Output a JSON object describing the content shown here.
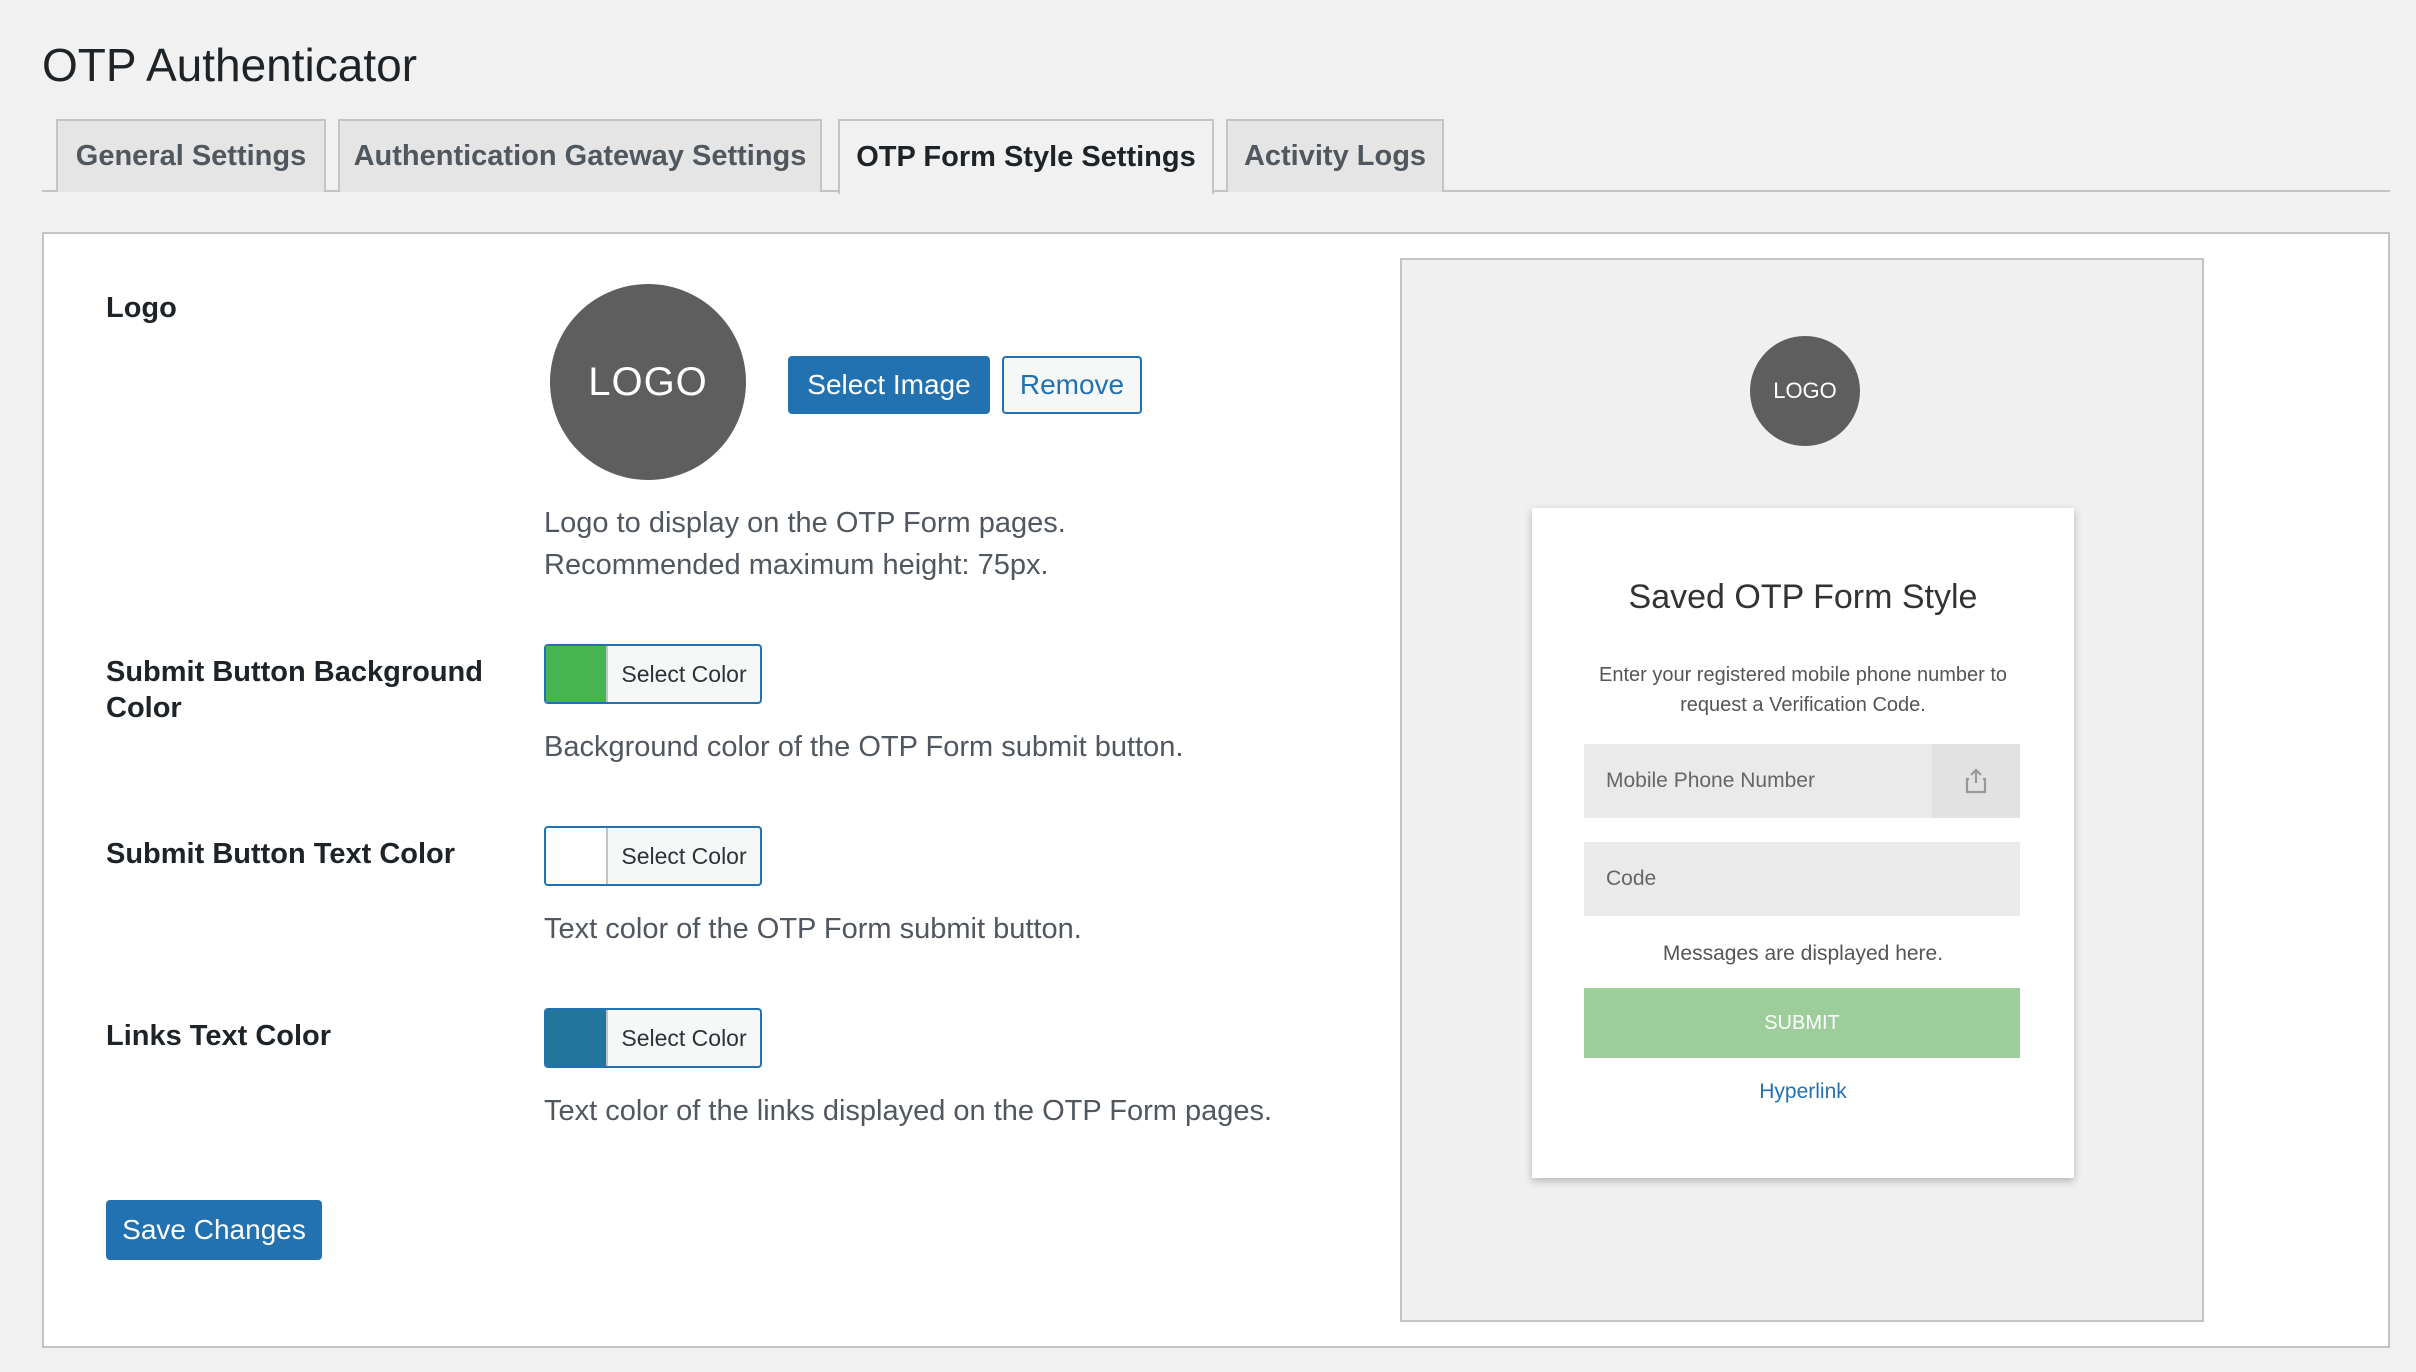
{
  "page": {
    "title": "OTP Authenticator"
  },
  "tabs": [
    {
      "label": "General Settings",
      "active": false
    },
    {
      "label": "Authentication Gateway Settings",
      "active": false
    },
    {
      "label": "OTP Form Style Settings",
      "active": true
    },
    {
      "label": "Activity Logs",
      "active": false
    }
  ],
  "logo": {
    "label": "Logo",
    "placeholder_text": "LOGO",
    "select_button": "Select Image",
    "remove_button": "Remove",
    "desc_line1": "Logo to display on the OTP Form pages.",
    "desc_line2": "Recommended maximum height: 75px."
  },
  "submit_bg": {
    "label_line1": "Submit Button Background",
    "label_line2": "Color",
    "picker_label": "Select Color",
    "color": "#46b450",
    "desc": "Background color of the OTP Form submit button."
  },
  "submit_text": {
    "label": "Submit Button Text Color",
    "picker_label": "Select Color",
    "color": "#ffffff",
    "desc": "Text color of the OTP Form submit button."
  },
  "links_color": {
    "label": "Links Text Color",
    "picker_label": "Select Color",
    "color": "#21759b",
    "desc": "Text color of the links displayed on the OTP Form pages."
  },
  "save_button": "Save Changes",
  "preview": {
    "logo_text": "LOGO",
    "title": "Saved OTP Form Style",
    "instruction": "Enter your registered mobile phone number to request a Verification Code.",
    "phone_placeholder": "Mobile Phone Number",
    "share_icon": "share-icon",
    "code_placeholder": "Code",
    "message": "Messages are displayed here.",
    "submit": "SUBMIT",
    "link": "Hyperlink"
  }
}
